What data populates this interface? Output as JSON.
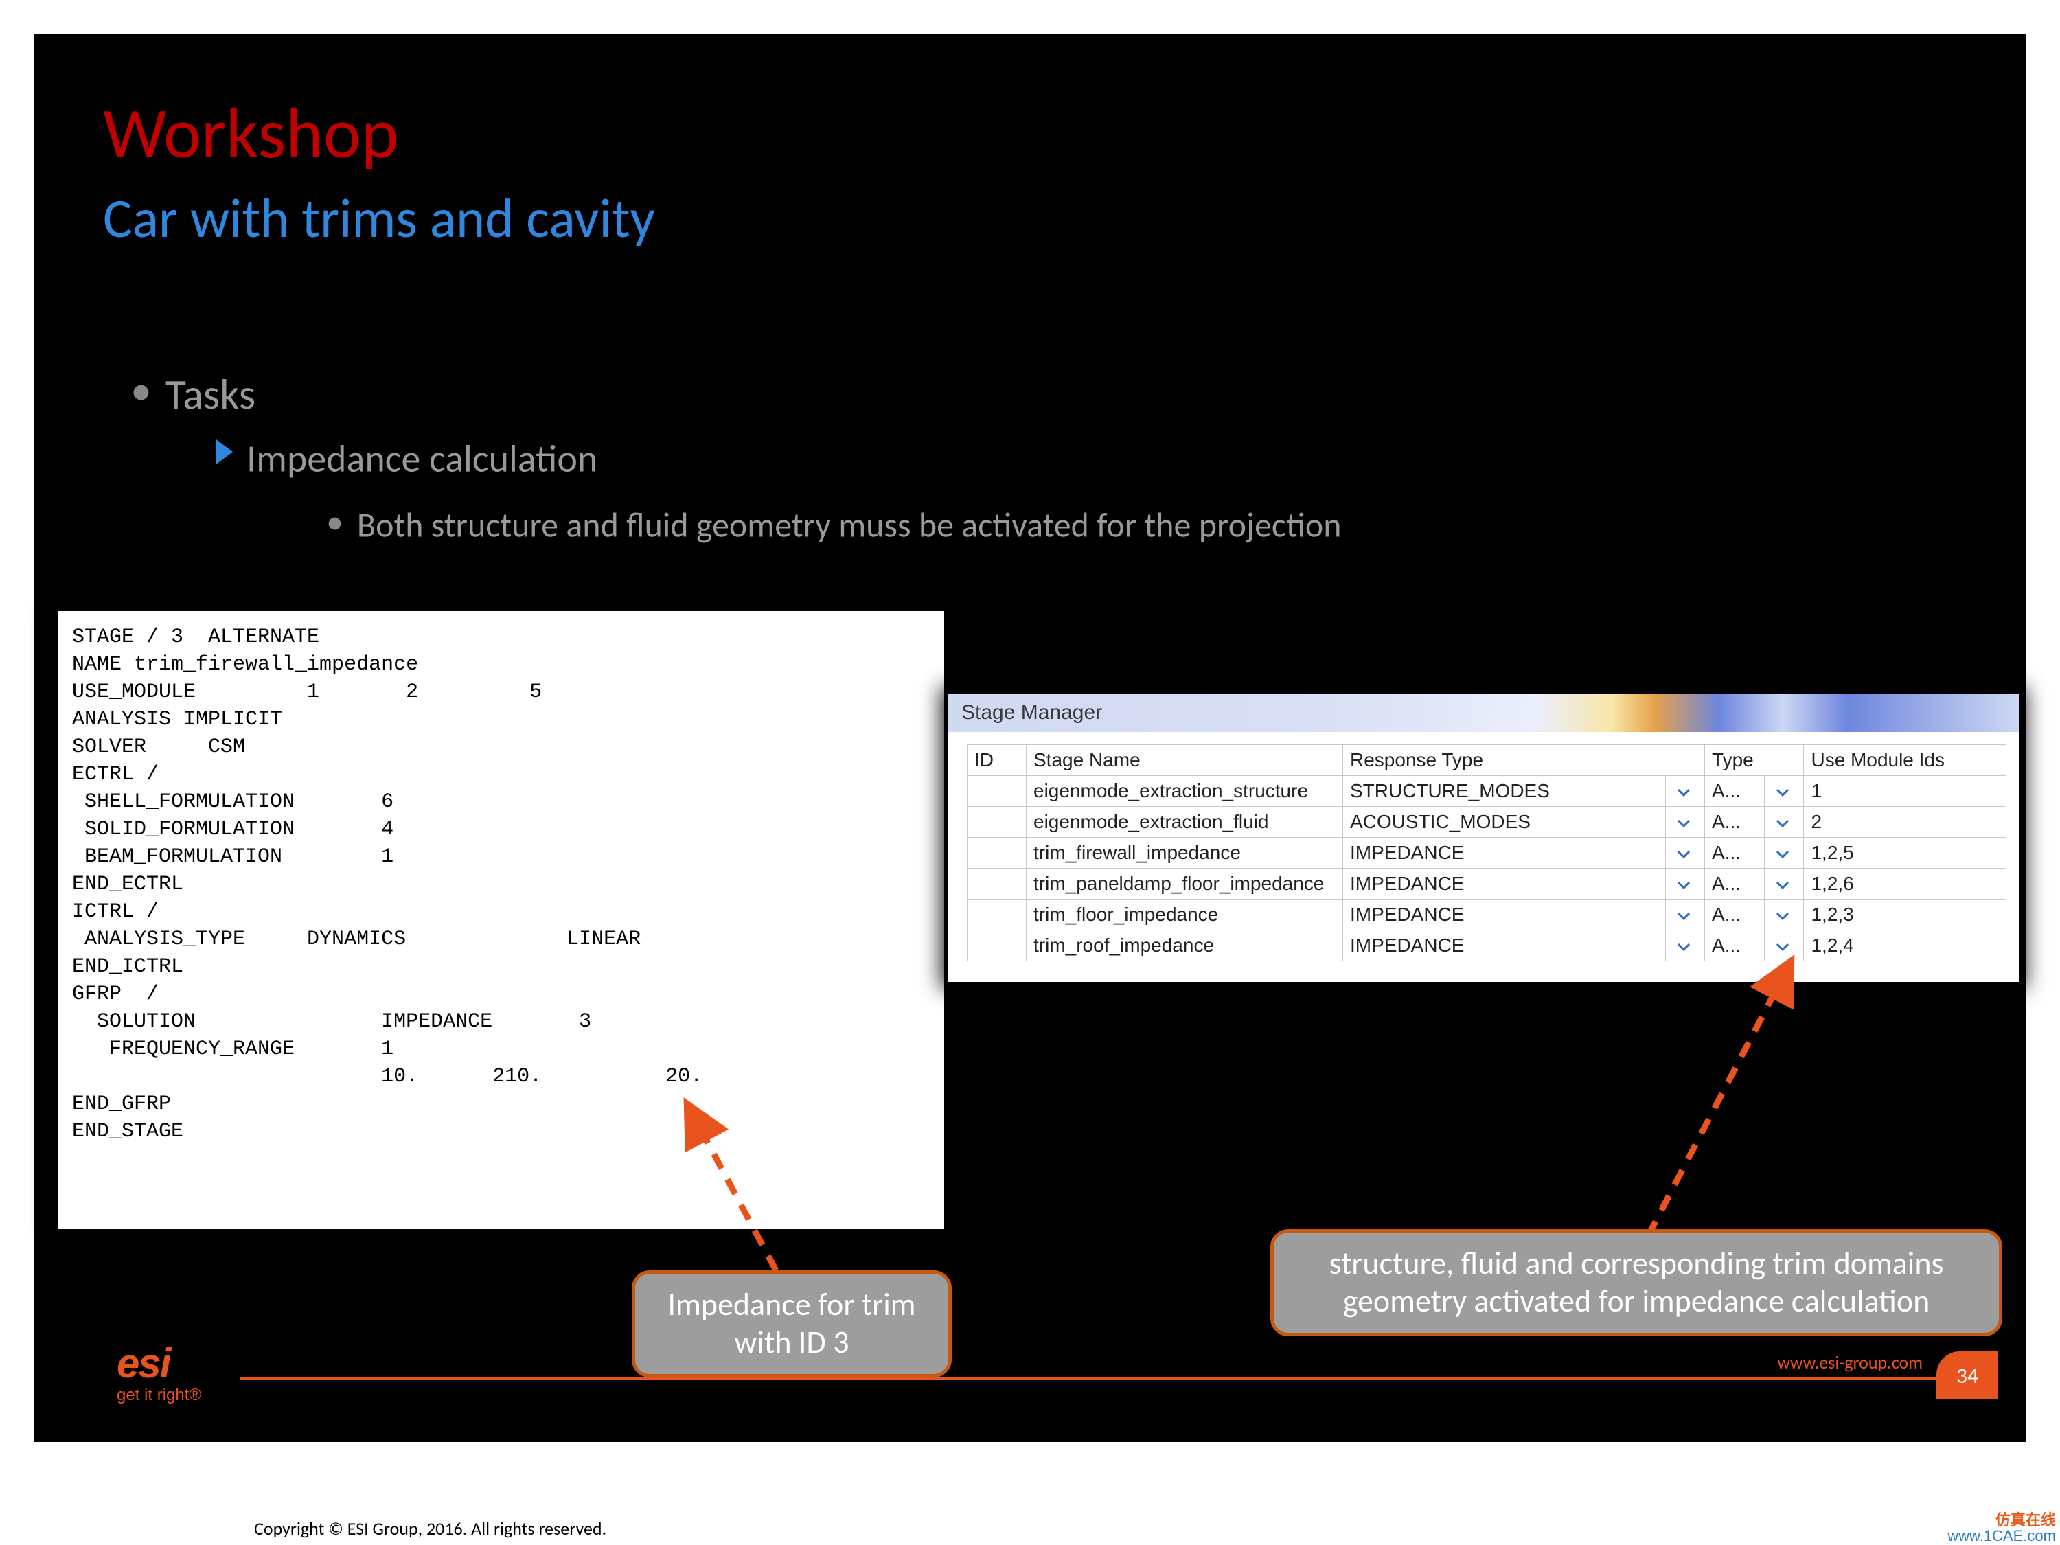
{
  "title": "Workshop",
  "subtitle": "Car with trims and cavity",
  "bullets": {
    "b1": "Tasks",
    "b2": "Impedance calculation",
    "b3": "Both structure and fluid geometry muss be activated for the projection"
  },
  "code": "STAGE / 3  ALTERNATE\nNAME trim_firewall_impedance\nUSE_MODULE         1       2         5\nANALYSIS IMPLICIT\nSOLVER     CSM\nECTRL /\n SHELL_FORMULATION       6\n SOLID_FORMULATION       4\n BEAM_FORMULATION        1\nEND_ECTRL\nICTRL /\n ANALYSIS_TYPE     DYNAMICS             LINEAR\nEND_ICTRL\nGFRP  /\n  SOLUTION               IMPEDANCE       3\n   FREQUENCY_RANGE       1\n                         10.      210.          20.\nEND_GFRP\nEND_STAGE",
  "sm": {
    "title": "Stage Manager",
    "headers": {
      "id": "ID",
      "name": "Stage Name",
      "resp": "Response Type",
      "type": "Type",
      "mods": "Use Module Ids"
    },
    "rows": [
      {
        "name": "eigenmode_extraction_structure",
        "resp": "STRUCTURE_MODES",
        "type": "A...",
        "mods": "1"
      },
      {
        "name": "eigenmode_extraction_fluid",
        "resp": "ACOUSTIC_MODES",
        "type": "A...",
        "mods": "2"
      },
      {
        "name": "trim_firewall_impedance",
        "resp": "IMPEDANCE",
        "type": "A...",
        "mods": "1,2,5"
      },
      {
        "name": "trim_paneldamp_floor_impedance",
        "resp": "IMPEDANCE",
        "type": "A...",
        "mods": "1,2,6"
      },
      {
        "name": "trim_floor_impedance",
        "resp": "IMPEDANCE",
        "type": "A...",
        "mods": "1,2,3"
      },
      {
        "name": "trim_roof_impedance",
        "resp": "IMPEDANCE",
        "type": "A...",
        "mods": "1,2,4"
      }
    ]
  },
  "callouts": {
    "c1": "Impedance for trim with ID 3",
    "c2": "structure, fluid and corresponding trim domains geometry activated for impedance calculation"
  },
  "footer": {
    "logo": "esi",
    "logoSub": "get it right®",
    "url": "www.esi-group.com",
    "page": "34",
    "copyright": "Copyright © ESI Group, 2016. All rights reserved."
  },
  "watermark": {
    "cn": "仿真在线",
    "url": "www.1CAE.com"
  }
}
